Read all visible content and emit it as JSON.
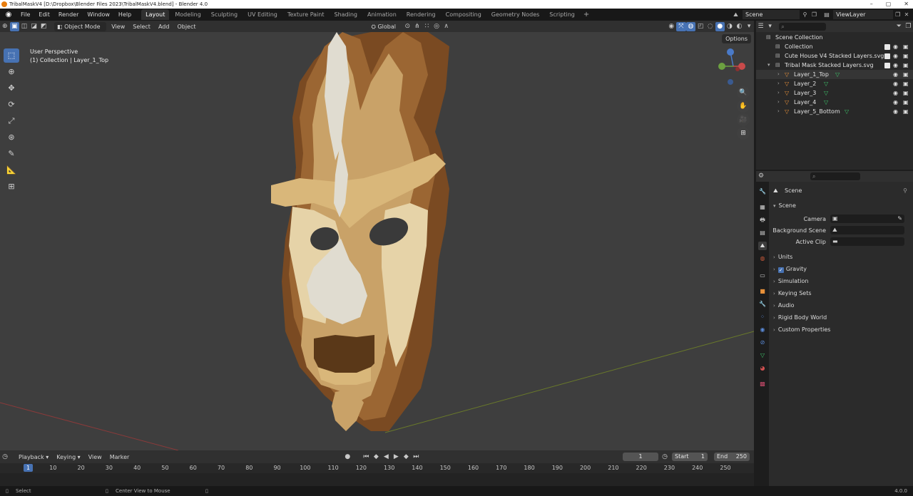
{
  "window": {
    "title": "TribalMaskV4 [D:\\Dropbox\\Blender Files 2023\\TribalMaskV4.blend] - Blender 4.0",
    "controls": [
      "–",
      "▢",
      "✕"
    ]
  },
  "menu": [
    "File",
    "Edit",
    "Render",
    "Window",
    "Help"
  ],
  "workspaces": [
    "Layout",
    "Modeling",
    "Sculpting",
    "UV Editing",
    "Texture Paint",
    "Shading",
    "Animation",
    "Rendering",
    "Compositing",
    "Geometry Nodes",
    "Scripting"
  ],
  "active_workspace": "Layout",
  "scene_selector": "Scene",
  "view_layer": "ViewLayer",
  "viewport_header": {
    "mode": "Object Mode",
    "menus": [
      "View",
      "Select",
      "Add",
      "Object"
    ],
    "orientation": "Global",
    "options": "Options"
  },
  "viewport": {
    "perspective": "User Perspective",
    "collection_info": "(1) Collection | Layer_1_Top",
    "colors": {
      "background": "#3e3e3e",
      "mask_light": "#d9c29a",
      "mask_mid": "#c9a268",
      "mask_dark": "#7a4a22",
      "mask_pale": "#e0dcd0"
    }
  },
  "tools": [
    "select-box-icon",
    "cursor-icon",
    "move-icon",
    "rotate-icon",
    "scale-icon",
    "transform-icon",
    "annotate-icon",
    "measure-icon",
    "add-cube-icon"
  ],
  "timeline": {
    "menus": [
      "Playback",
      "Keying",
      "View",
      "Marker"
    ],
    "current_frame": "1",
    "start_label": "Start",
    "start": "1",
    "end_label": "End",
    "end": "250",
    "ticks": [
      "1",
      "10",
      "20",
      "30",
      "40",
      "50",
      "60",
      "70",
      "80",
      "90",
      "100",
      "110",
      "120",
      "130",
      "140",
      "150",
      "160",
      "170",
      "180",
      "190",
      "200",
      "210",
      "220",
      "230",
      "240",
      "250"
    ]
  },
  "statusbar": {
    "left": "Select",
    "middle": "Center View to Mouse",
    "version": "4.0.0"
  },
  "outliner": {
    "rows": [
      {
        "label": "Scene Collection"
      },
      {
        "label": "Collection"
      },
      {
        "label": "Cute House V4 Stacked Layers.svg"
      },
      {
        "label": "Tribal Mask Stacked Layers.svg"
      },
      {
        "label": "Layer_1_Top"
      },
      {
        "label": "Layer_2"
      },
      {
        "label": "Layer_3"
      },
      {
        "label": "Layer_4"
      },
      {
        "label": "Layer_5_Bottom"
      }
    ]
  },
  "properties": {
    "context": "Scene",
    "panel": "Scene",
    "fields": [
      {
        "label": "Camera"
      },
      {
        "label": "Background Scene"
      },
      {
        "label": "Active Clip"
      }
    ],
    "subpanels": [
      "Units",
      "Gravity",
      "Simulation",
      "Keying Sets",
      "Audio",
      "Rigid Body World",
      "Custom Properties"
    ]
  }
}
